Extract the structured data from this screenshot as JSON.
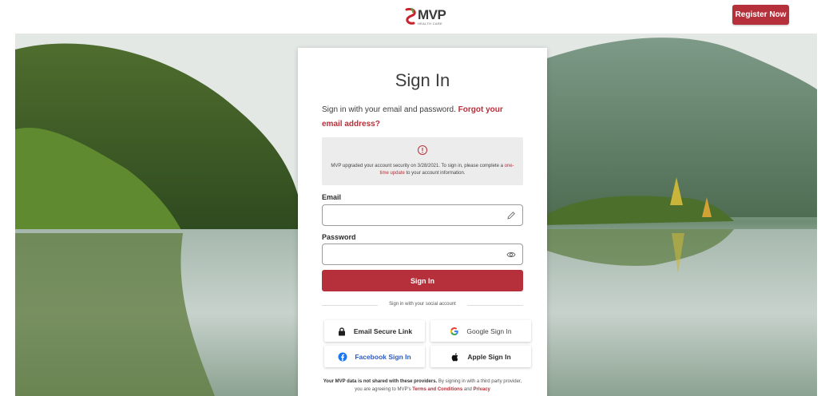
{
  "header": {
    "logo_text": "MVP",
    "logo_subtext": "HEALTH CARE",
    "register_label": "Register Now"
  },
  "form": {
    "title": "Sign In",
    "intro_text": "Sign in with your email and password. ",
    "intro_link": "Forgot your email address?",
    "notice": {
      "text_before": "MVP upgraded your account security on 3/28/2021. To sign in, please complete a ",
      "link": "one-time update",
      "text_after": " to your account information."
    },
    "email_label": "Email",
    "email_value": "",
    "password_label": "Password",
    "password_value": "",
    "signin_label": "Sign In",
    "social_divider": "Sign in with your social account",
    "social_buttons": {
      "email_link": "Email Secure Link",
      "google": "Google Sign In",
      "facebook": "Facebook Sign In",
      "apple": "Apple Sign In"
    },
    "footer": {
      "bold": "Your MVP data is not shared with these providers.",
      "text": " By signing in with a third party provider, you are agreeing to MVP's ",
      "link_terms": "Terms and Conditions",
      "and": " and ",
      "link_privacy": "Privacy"
    }
  },
  "colors": {
    "brand_red": "#b5303a",
    "facebook_blue": "#1877f2"
  },
  "icons": [
    "mvp-logo-icon",
    "alert-circle-icon",
    "pencil-icon",
    "eye-icon",
    "lock-icon",
    "google-icon",
    "facebook-icon",
    "apple-icon"
  ]
}
